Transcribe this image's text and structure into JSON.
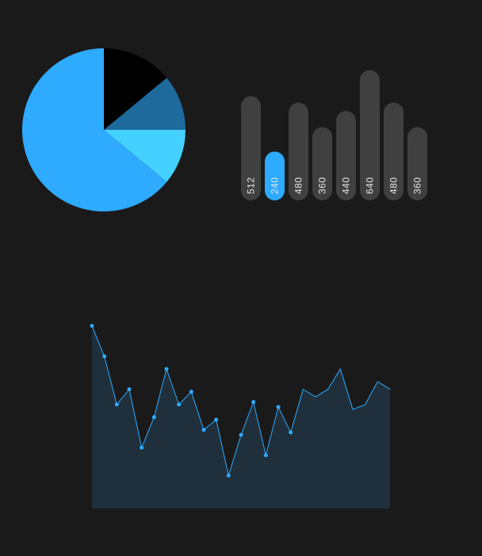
{
  "colors": {
    "background": "#1a1a1a",
    "pie": [
      "#000000",
      "#1e6a9d",
      "#45d1ff",
      "#2eaaff"
    ],
    "bar_default": "#404040",
    "bar_highlight": "#2eaaff",
    "bar_label": "#e8e8e8",
    "area_fill": "#1f303c",
    "line": "#2eaaff",
    "marker": "#2eaaff"
  },
  "chart_data": [
    {
      "type": "pie",
      "values": [
        14,
        11,
        11,
        64
      ],
      "start": "12 o'clock",
      "direction": "clockwise"
    },
    {
      "type": "bar",
      "orientation": "vertical",
      "values": [
        512,
        240,
        480,
        360,
        440,
        640,
        480,
        360
      ],
      "labels": [
        "512",
        "240",
        "480",
        "360",
        "440",
        "640",
        "480",
        "360"
      ],
      "highlight_index": 1,
      "ylim": [
        0,
        720
      ],
      "rounded": true
    },
    {
      "type": "area",
      "y": [
        100,
        88,
        69,
        75,
        52,
        64,
        83,
        69,
        74,
        59,
        63,
        41,
        57,
        70,
        49,
        68,
        58,
        75,
        72,
        75,
        83,
        67,
        69,
        78,
        75
      ],
      "markers_on_first": 17,
      "ylim": [
        28,
        102
      ],
      "grid": false,
      "legend": "none"
    }
  ]
}
